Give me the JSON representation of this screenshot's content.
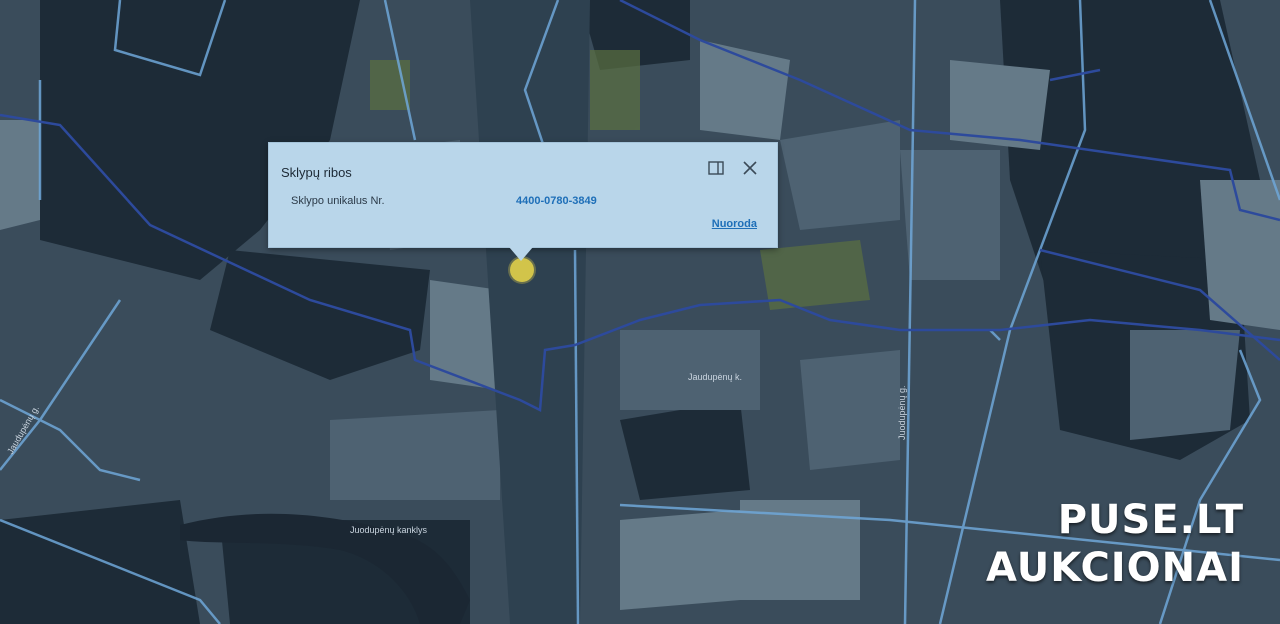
{
  "popup": {
    "title": "Sklypų ribos",
    "row_label": "Sklypo unikalus Nr.",
    "row_value": "4400-0780-3849",
    "link_label": "Nuoroda",
    "dock_icon": "dock-icon",
    "close_icon": "close-icon"
  },
  "map": {
    "labels": {
      "village1": "Jaudupėnų k.",
      "village2": "Juodupėnų kanklys",
      "road1": "Jaudupėnų g.",
      "road2": "Juodupėnų g."
    }
  },
  "watermark": {
    "line1": "PUSE.LT",
    "line2": "AUKCIONAI"
  },
  "colors": {
    "popup_bg": "#b9d6ea",
    "link": "#1e6fb8",
    "boundary": "#2d4a9c",
    "road": "#6fa7d8",
    "marker": "#d2c44a"
  }
}
